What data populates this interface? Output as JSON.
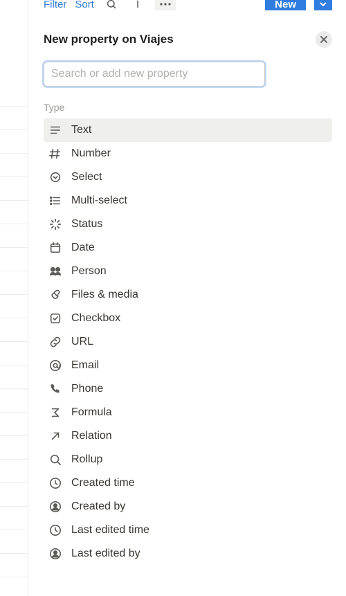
{
  "toolbar": {
    "filter_label": "Filter",
    "sort_label": "Sort",
    "new_label": "New"
  },
  "header": {
    "title": "New property on Viajes"
  },
  "search": {
    "placeholder": "Search or add new property",
    "value": ""
  },
  "section_label": "Type",
  "types": [
    {
      "icon": "text",
      "label": "Text",
      "selected": true
    },
    {
      "icon": "number",
      "label": "Number"
    },
    {
      "icon": "select",
      "label": "Select"
    },
    {
      "icon": "multi-select",
      "label": "Multi-select"
    },
    {
      "icon": "status",
      "label": "Status"
    },
    {
      "icon": "date",
      "label": "Date"
    },
    {
      "icon": "person",
      "label": "Person"
    },
    {
      "icon": "files",
      "label": "Files & media"
    },
    {
      "icon": "checkbox",
      "label": "Checkbox"
    },
    {
      "icon": "url",
      "label": "URL"
    },
    {
      "icon": "email",
      "label": "Email"
    },
    {
      "icon": "phone",
      "label": "Phone"
    },
    {
      "icon": "formula",
      "label": "Formula"
    },
    {
      "icon": "relation",
      "label": "Relation"
    },
    {
      "icon": "rollup",
      "label": "Rollup"
    },
    {
      "icon": "created-time",
      "label": "Created time"
    },
    {
      "icon": "created-by",
      "label": "Created by"
    },
    {
      "icon": "last-edited-time",
      "label": "Last edited time"
    },
    {
      "icon": "last-edited-by",
      "label": "Last edited by"
    }
  ]
}
